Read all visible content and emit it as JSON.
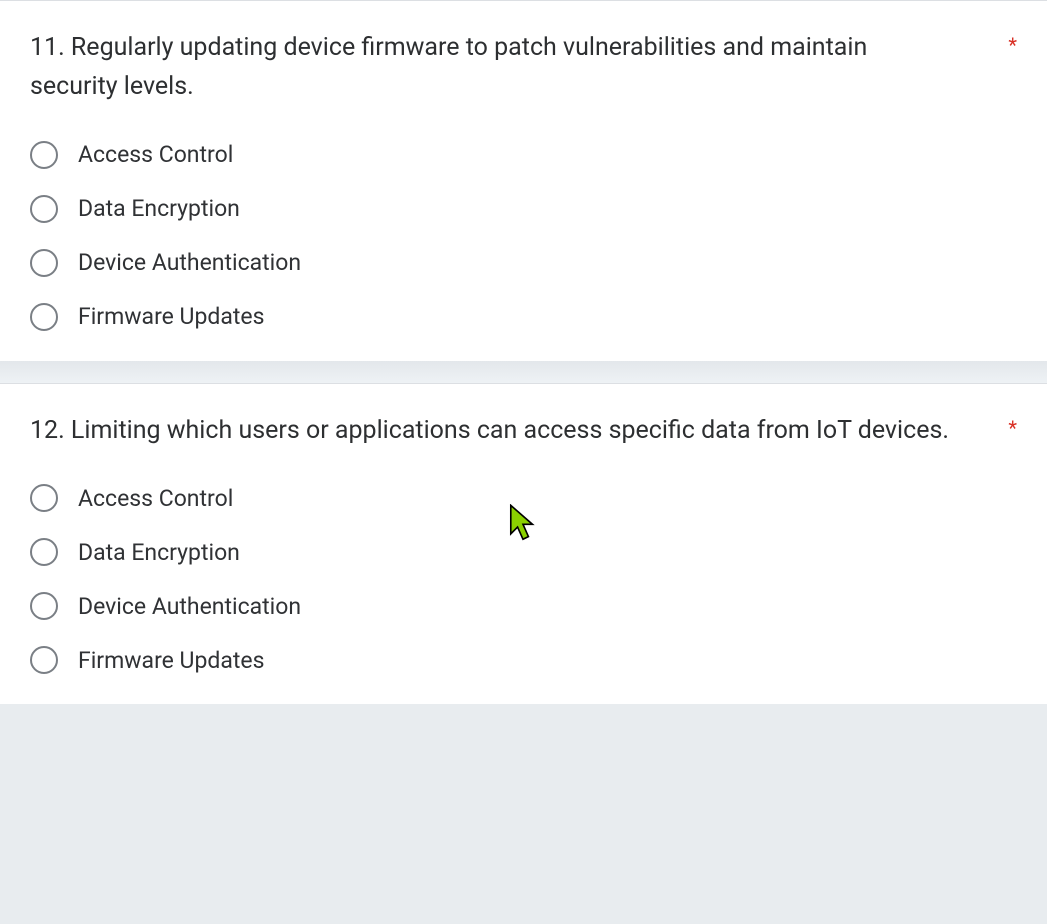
{
  "questions": [
    {
      "number": "11.",
      "text": "Regularly updating device firmware to patch vulnerabilities and maintain security levels.",
      "required_mark": "*",
      "options": [
        "Access Control",
        "Data Encryption",
        "Device Authentication",
        "Firmware Updates"
      ]
    },
    {
      "number": "12.",
      "text": "Limiting which users or applications can access specific data from IoT devices.",
      "required_mark": "*",
      "options": [
        "Access Control",
        "Data Encryption",
        "Device Authentication",
        "Firmware Updates"
      ]
    }
  ]
}
